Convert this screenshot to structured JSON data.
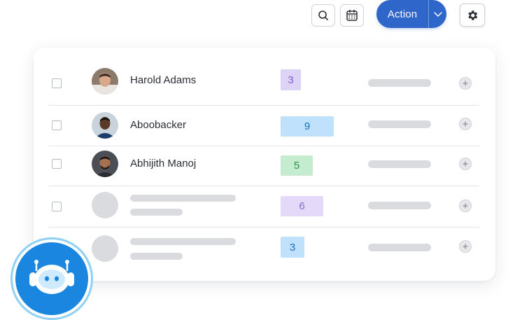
{
  "toolbar": {
    "search_icon": "search-icon",
    "calendar_icon": "calendar-icon",
    "action_label": "Action",
    "action_caret_icon": "chevron-down-icon",
    "settings_icon": "gear-icon",
    "accent_color": "#2f66c9"
  },
  "rows": [
    {
      "name": "Harold Adams",
      "count": "3",
      "badge_bg": "#dcd3f7",
      "badge_fg": "#7a5fd6"
    },
    {
      "name": "Aboobacker",
      "count": "9",
      "badge_bg": "#bfe1fb",
      "badge_fg": "#1f6fc3"
    },
    {
      "name": "Abhijith Manoj",
      "count": "5",
      "badge_bg": "#c6ecd0",
      "badge_fg": "#239448"
    },
    {
      "name": "",
      "count": "6",
      "badge_bg": "#e4d9f8",
      "badge_fg": "#8a6ad8"
    },
    {
      "name": "",
      "count": "3",
      "badge_bg": "#bfe1fb",
      "badge_fg": "#1f6fc3"
    }
  ],
  "bot": {
    "icon": "robot-icon",
    "color": "#1a86e0"
  }
}
